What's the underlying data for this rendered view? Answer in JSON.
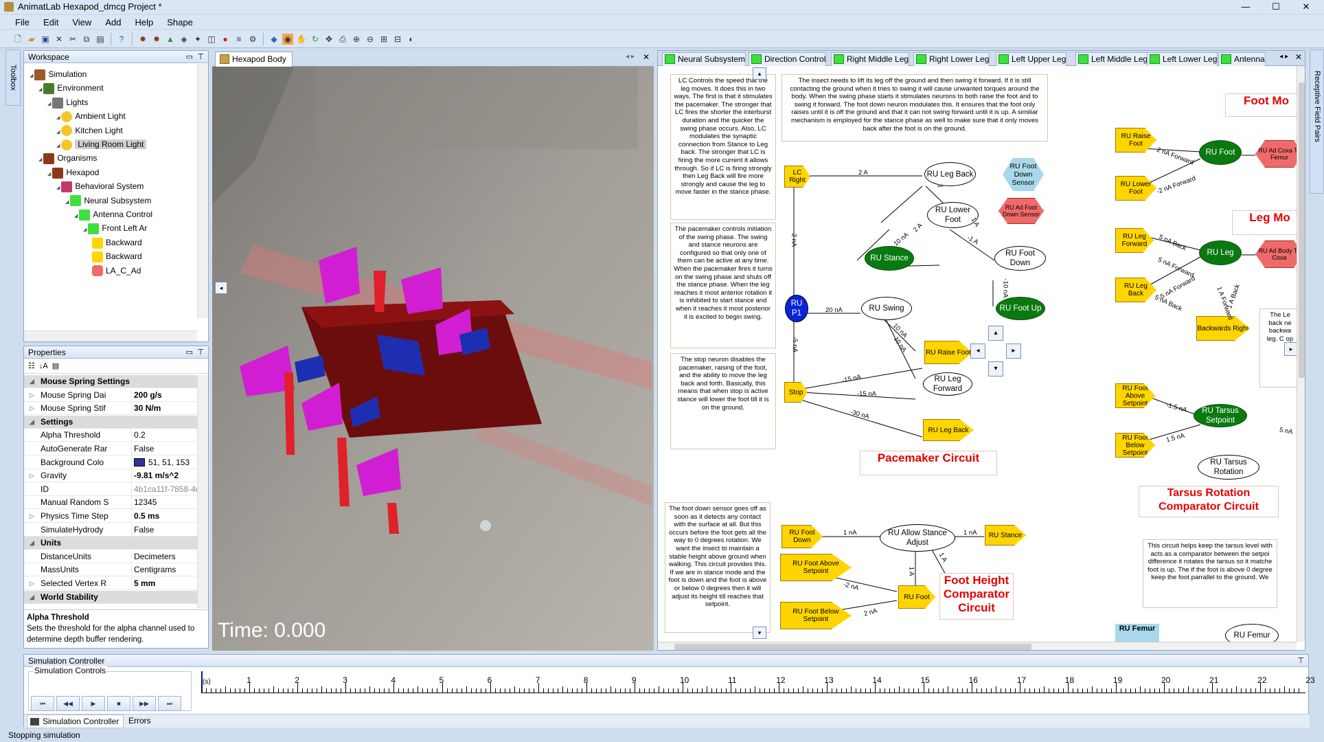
{
  "app": {
    "title": "AnimatLab Hexapod_dmcg Project *",
    "menu": [
      "File",
      "Edit",
      "View",
      "Add",
      "Help",
      "Shape"
    ]
  },
  "workspace": {
    "title": "Workspace",
    "tree": [
      {
        "label": "Simulation",
        "icon": "simulation-icon",
        "depth": 0
      },
      {
        "label": "Environment",
        "icon": "environment-icon",
        "depth": 1
      },
      {
        "label": "Lights",
        "icon": "lights-icon",
        "depth": 2
      },
      {
        "label": "Ambient Light",
        "icon": "bulb-icon",
        "depth": 3
      },
      {
        "label": "Kitchen Light",
        "icon": "bulb-icon",
        "depth": 3
      },
      {
        "label": "Living Room Light",
        "icon": "bulb-icon",
        "depth": 3,
        "selected": true
      },
      {
        "label": "Organisms",
        "icon": "organisms-icon",
        "depth": 1
      },
      {
        "label": "Hexapod",
        "icon": "insect-icon",
        "depth": 2
      },
      {
        "label": "Behavioral System",
        "icon": "neuron-icon",
        "depth": 3
      },
      {
        "label": "Neural Subsystem",
        "icon": "subsystem-icon",
        "depth": 4
      },
      {
        "label": "Antenna Control",
        "icon": "subsystem-icon",
        "depth": 5
      },
      {
        "label": "Front Left Ar",
        "icon": "subsystem-icon",
        "depth": 6
      },
      {
        "label": "Backward",
        "icon": "neuron-yellow-icon",
        "depth": 7
      },
      {
        "label": "Backward",
        "icon": "neuron-yellow-icon",
        "depth": 7
      },
      {
        "label": "LA_C_Ad",
        "icon": "neuron-red-icon",
        "depth": 7
      }
    ]
  },
  "properties": {
    "title": "Properties",
    "rows": [
      {
        "cat": true,
        "name": "Mouse Spring Settings"
      },
      {
        "name": "Mouse Spring Dai",
        "value": "200 g/s",
        "bold": true,
        "exp": true
      },
      {
        "name": "Mouse Spring Stif",
        "value": "30 N/m",
        "bold": true,
        "exp": true
      },
      {
        "cat": true,
        "name": "Settings"
      },
      {
        "name": "Alpha Threshold",
        "value": "0.2"
      },
      {
        "name": "AutoGenerate Rar",
        "value": "False"
      },
      {
        "name": "Background Colo",
        "value": "51, 51, 153",
        "swatch": "#333399"
      },
      {
        "name": "Gravity",
        "value": "-9.81 m/s^2",
        "bold": true,
        "exp": true
      },
      {
        "name": "ID",
        "value": "4b1ca11f-7858-4d11-b8e",
        "grey": true
      },
      {
        "name": "Manual Random S",
        "value": "12345"
      },
      {
        "name": "Physics Time Step",
        "value": "0.5 ms",
        "bold": true,
        "exp": true
      },
      {
        "name": "SimulateHydrody",
        "value": "False"
      },
      {
        "cat": true,
        "name": "Units"
      },
      {
        "name": "DistanceUnits",
        "value": "Decimeters"
      },
      {
        "name": "MassUnits",
        "value": "Centigrams"
      },
      {
        "name": "Selected Vertex R",
        "value": "5 mm",
        "bold": true,
        "exp": true
      },
      {
        "cat": true,
        "name": "World Stability"
      }
    ],
    "desc_title": "Alpha Threshold",
    "desc_text": "Sets the threshold for the alpha channel used to determine depth buffer rendering."
  },
  "view": {
    "tab": "Hexapod Body",
    "time": "Time: 0.000",
    "bg": "#8b8883"
  },
  "circuit": {
    "tabs": [
      "Neural Subsystem",
      "Direction Control",
      "Right Middle Leg",
      "Right Lower Leg",
      "Left Upper Leg",
      "Left Middle Leg",
      "Left Lower Leg",
      "Antenna"
    ],
    "notes": [
      "LC Controls the speed that the leg moves. It does this in two ways. The first is that it stimulates the pacemaker. The stronger that LC fires the shorter the interburst duration and the quicker the swing phase occurs. Also, LC modulates the synaptic connection from Stance to Leg back. The stronger that LC is firing the more current it allows through. So if LC is firing strongly then Leg Back will fire more strongly and cause the leg to move faster in the stance phase.",
      "The pacemaker controls initiation of the swing phase. The swing and stance neurons are configured so that only one of them can be active at any time. When the pacemaker fires it turns on the swing phase and shuts off the stance phase. When the leg reaches it most anterior rotation it is inhibited to start stance and when it reaches it most posterior it is excited to begin swing.",
      "The stop neuron disables the pacemaker, raising of the foot, and the ability to move the leg back and forth. Basically, this means that when stop is active stance will lower the foot till it is on the ground.",
      "The insect needs to lift its leg off the ground and then swing it forward. If it is still contacting the ground when it tries to swing it will cause unwanted torques around the body. When the swing phase starts it stimulates neurons to both raise the foot and to swing it forward. The foot down neuron modulates this. It ensures that the foot only raises until it is off the ground and that it can not swing forward until it is up. A similiar mechanism is employed for the stance phase as well to make sure that it only moves back after the foot is on the ground.",
      "The foot down sensor goes off as soon as it detects any contact with the surface at all. But this occurs before the foot gets all the way to 0 degrees rotation. We want the insect to maintain a stable height above ground when walking. This circuit provides this. If we are in stance mode and the foot is down and the foot is above or below 0 degrees then it will adjust its height till reaches that setpoint.",
      "This circuit helps keep the tarsus level with acts as a comparator between the setpoi difference it rotates the tarsus so it matche foot is up. The if the foot is above 0 degree keep the foot parrallel to the ground. We",
      "The Le back ne backwa leg. C op"
    ],
    "titles": [
      "Pacemaker Circuit",
      "Foot Height Comparator Circuit",
      "Tarsus Rotation Comparator Circuit",
      "Foot Mo",
      "Leg Mo"
    ],
    "nodes": [
      "LC Right",
      "RU Leg Back",
      "RU Foot Down Sensor",
      "RU Lower Foot",
      "RU Ad Foot Down Sensor",
      "RU Stance",
      "RU Foot Down",
      "RU P1",
      "RU Swing",
      "RU Foot Up",
      "RU Raise Foot",
      "RU Leg Forward",
      "Stop",
      "RU Leg Back",
      "RU Foot Down",
      "RU Allow Stance Adjust",
      "RU Stance",
      "RU Foot Above Setpoint",
      "RU Foot Below Setpoint",
      "RU Foot",
      "RU Raise Foot",
      "RU Lower Foot",
      "RU Foot",
      "RU Ad Coxa To Femur",
      "RU Leg Forward",
      "RU Leg Back",
      "RU Leg",
      "RU Ad Body To Coxa",
      "Backwards Right",
      "RU Foot Above Setpoint",
      "RU Foot Below Setpoint",
      "RU Tarsus Setpoint",
      "RU Tarsus Rotation",
      "RU Femur",
      "RU Femur"
    ],
    "edges": [
      "2 A",
      "2 nA",
      "-5 nA",
      "20 nA",
      "10 nA",
      "2 A",
      "-1 A",
      "1 A",
      "-10 nA",
      "10 nA",
      "10 nA",
      "-15 nA",
      "-15 nA",
      "-30 nA",
      "1 nA",
      "1 nA",
      "1 A",
      "1 A",
      "-2 nA",
      "2 nA",
      "2 nA Forward",
      "-2 nA Forward",
      "5 nA Back",
      "5 nA Forward",
      "-5 nA Forward",
      "5 nA Back",
      "1 A Back",
      "1 A Forward",
      "-1.5 nA",
      "1.5 nA",
      "5 nA"
    ]
  },
  "sim": {
    "title": "Simulation Controller",
    "group": "Simulation Controls",
    "buttons": [
      "⏮",
      "◀◀",
      "▶",
      "■",
      "▶▶",
      "⏭"
    ],
    "ruler_start": "(s)",
    "ruler_labels": [
      "1",
      "2",
      "3",
      "4",
      "5",
      "6",
      "7",
      "8",
      "9",
      "10",
      "11",
      "12",
      "13",
      "14",
      "15",
      "16",
      "17",
      "18",
      "19",
      "20",
      "21",
      "22",
      "23"
    ],
    "tabs": [
      "Simulation Controller",
      "Errors"
    ]
  },
  "lefttool": "Toolbox",
  "righttool": "Receptive Field Pairs",
  "status": "Stopping simulation"
}
